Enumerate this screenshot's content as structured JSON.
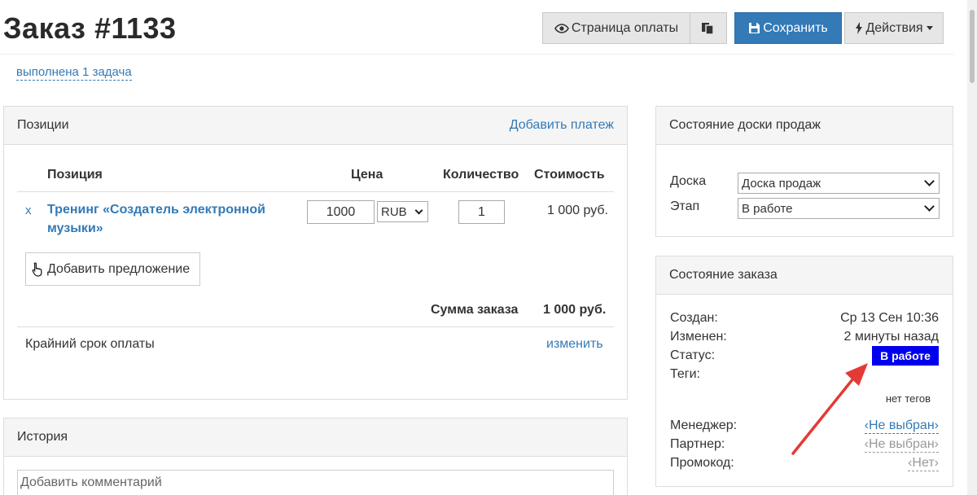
{
  "header": {
    "title": "Заказ #1133",
    "task_link": "выполнена 1 задача"
  },
  "toolbar": {
    "payment_page": "Страница оплаты",
    "save": "Сохранить",
    "actions": "Действия"
  },
  "positions": {
    "title": "Позиции",
    "add_payment": "Добавить платеж",
    "columns": {
      "position": "Позиция",
      "price": "Цена",
      "quantity": "Количество",
      "cost": "Стоимость"
    },
    "items": [
      {
        "remove": "x",
        "name": "Тренинг «Создатель электронной музыки»",
        "price": "1000",
        "currency": "RUB",
        "quantity": "1",
        "cost": "1 000 руб."
      }
    ],
    "add_offer": "Добавить предложение",
    "total_label": "Сумма заказа",
    "total_value": "1 000 руб.",
    "deadline_label": "Крайний срок оплаты",
    "deadline_change": "изменить"
  },
  "history": {
    "title": "История",
    "comment_placeholder": "Добавить комментарий"
  },
  "board": {
    "title": "Состояние доски продаж",
    "board_label": "Доска",
    "board_value": "Доска продаж",
    "stage_label": "Этап",
    "stage_value": "В работе"
  },
  "order_state": {
    "title": "Состояние заказа",
    "created_label": "Создан:",
    "created_value": "Ср 13 Сен 10:36",
    "modified_label": "Изменен:",
    "modified_value": "2 минуты назад",
    "status_label": "Статус:",
    "status_value": "В работе",
    "status_color": "#0000ee",
    "tags_label": "Теги:",
    "tags_value": "нет тегов",
    "manager_label": "Менеджер:",
    "manager_value": "‹Не выбран›",
    "partner_label": "Партнер:",
    "partner_value": "‹Не выбран›",
    "promo_label": "Промокод:",
    "promo_value": "‹Нет›"
  },
  "annotation": {
    "arrow_color": "#e53935"
  }
}
